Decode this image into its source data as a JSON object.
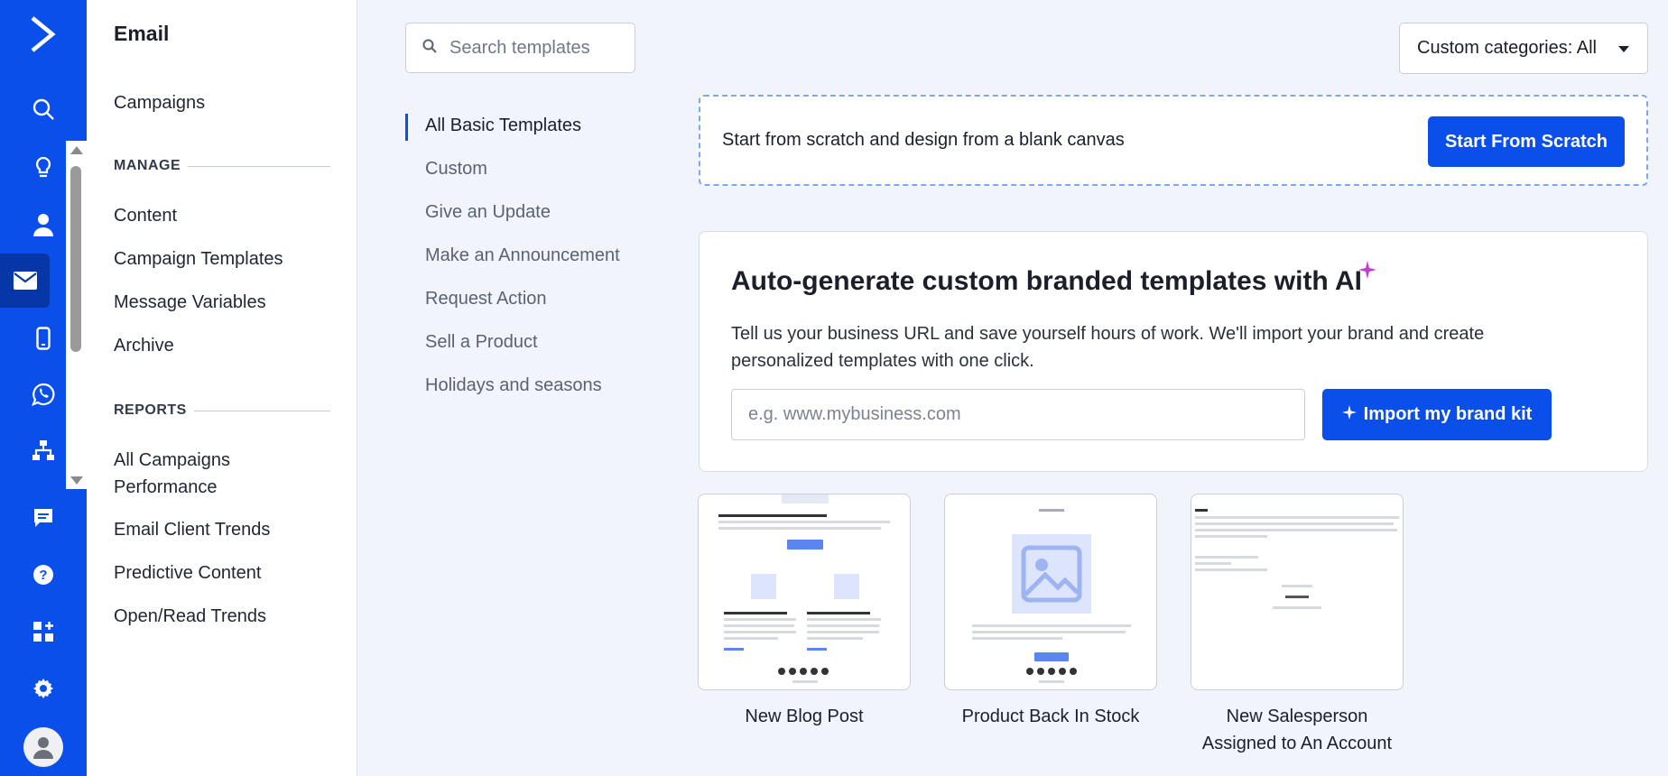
{
  "sidebar": {
    "title": "Email",
    "campaigns": "Campaigns",
    "manage_label": "MANAGE",
    "manage_items": [
      "Content",
      "Campaign Templates",
      "Message Variables",
      "Archive"
    ],
    "reports_label": "REPORTS",
    "report_items": [
      "All Campaigns Performance",
      "Email Client Trends",
      "Predictive Content",
      "Open/Read Trends"
    ]
  },
  "search": {
    "placeholder": "Search templates"
  },
  "categories_filter": {
    "label": "Custom categories: All"
  },
  "categories": {
    "active": "All Basic Templates",
    "items": [
      "All Basic Templates",
      "Custom",
      "Give an Update",
      "Make an Announcement",
      "Request Action",
      "Sell a Product",
      "Holidays and seasons"
    ]
  },
  "scratch": {
    "text": "Start from scratch and design from a blank canvas",
    "button": "Start From Scratch"
  },
  "ai_panel": {
    "title": "Auto-generate custom branded templates with AI",
    "description": "Tell us your business URL and save yourself hours of work. We'll import your brand and create personalized templates with one click.",
    "url_placeholder": "e.g. www.mybusiness.com",
    "button": "Import my brand kit"
  },
  "templates": [
    {
      "name": "New Blog Post"
    },
    {
      "name": "Product Back In Stock"
    },
    {
      "name": "New Salesperson Assigned to An Account"
    }
  ],
  "colors": {
    "brand_blue": "#0a4fe9",
    "rail_active": "#0636a8"
  },
  "icons": [
    "logo-icon",
    "search-icon",
    "lightbulb-icon",
    "contact-icon",
    "email-icon",
    "mobile-icon",
    "whatsapp-icon",
    "automation-icon",
    "chat-icon",
    "help-icon",
    "apps-icon",
    "settings-icon",
    "avatar-icon"
  ]
}
